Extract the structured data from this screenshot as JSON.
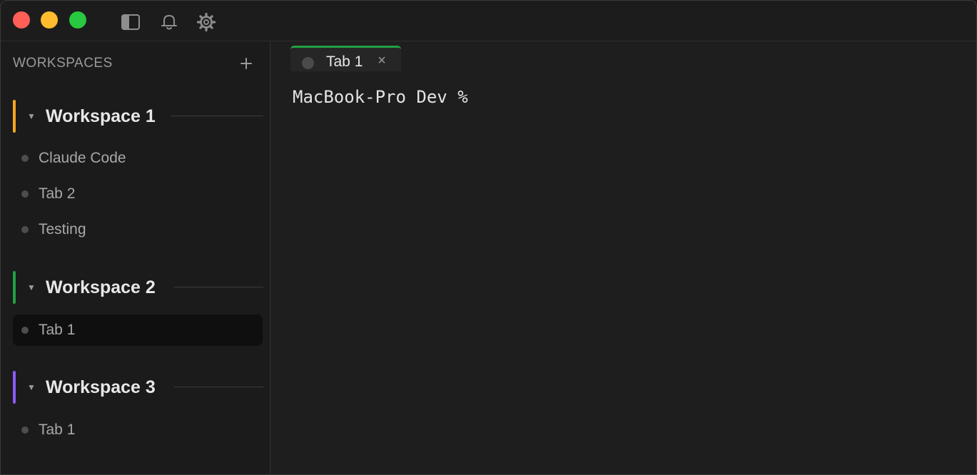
{
  "window": {
    "traffic_lights": {
      "close_color": "#ff5f57",
      "minimize_color": "#febc2e",
      "maximize_color": "#28c840"
    },
    "toolbar_icons": [
      "sidebar-toggle-icon",
      "bell-icon",
      "gear-icon"
    ]
  },
  "sidebar": {
    "header": "WORKSPACES",
    "add_icon": "plus-icon",
    "workspaces": [
      {
        "title": "Workspace 1",
        "color": "#f5a623",
        "expanded": true,
        "items": [
          {
            "label": "Claude Code",
            "active": false
          },
          {
            "label": "Tab 2",
            "active": false
          },
          {
            "label": "Testing",
            "active": false
          }
        ]
      },
      {
        "title": "Workspace 2",
        "color": "#22a043",
        "expanded": true,
        "items": [
          {
            "label": "Tab 1",
            "active": true
          }
        ]
      },
      {
        "title": "Workspace 3",
        "color": "#8b5cf6",
        "expanded": true,
        "items": [
          {
            "label": "Tab 1",
            "active": false
          }
        ]
      }
    ]
  },
  "main": {
    "tabs": [
      {
        "label": "Tab 1",
        "active": true,
        "accent": "#22a043",
        "close_glyph": "×"
      }
    ],
    "terminal": {
      "prompt": "MacBook-Pro Dev %"
    }
  }
}
